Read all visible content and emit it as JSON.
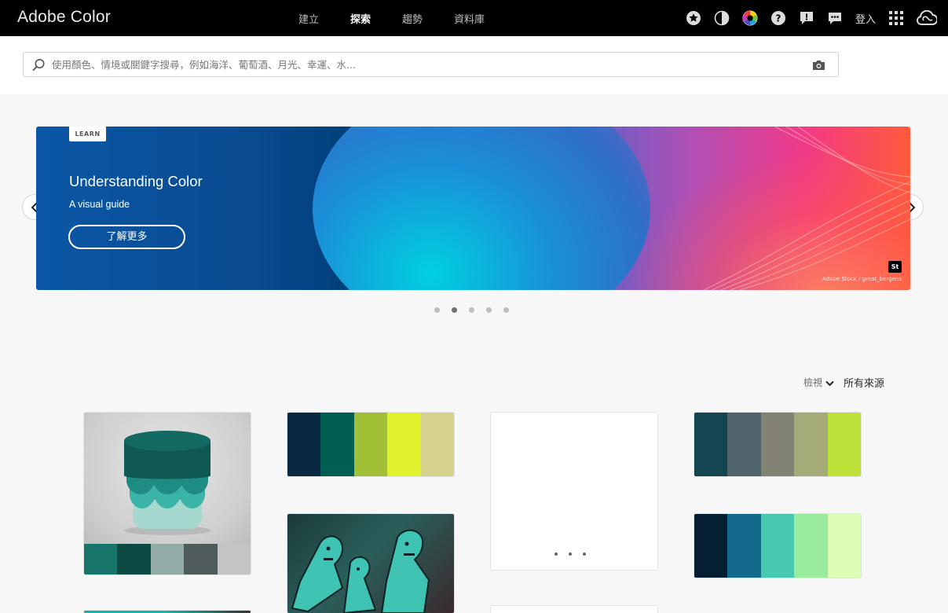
{
  "app": {
    "title": "Adobe Color"
  },
  "nav": {
    "items": [
      {
        "label": "建立",
        "active": false
      },
      {
        "label": "探索",
        "active": true
      },
      {
        "label": "趨勢",
        "active": false
      },
      {
        "label": "資料庫",
        "active": false
      }
    ]
  },
  "toolbar": {
    "icons": [
      "star-icon",
      "contrast-icon",
      "color-wheel-icon",
      "help-icon",
      "feedback-icon",
      "chat-icon"
    ],
    "login_label": "登入",
    "right_icons": [
      "apps-grid-icon",
      "creative-cloud-icon"
    ]
  },
  "search": {
    "placeholder": "使用顏色、情境或關鍵字搜尋，例如海洋、葡萄酒、月光、幸運、水...",
    "value": ""
  },
  "banner": {
    "tag": "LEARN",
    "title": "Understanding Color",
    "subtitle": "A visual guide",
    "button_label": "了解更多",
    "badge": "St",
    "credit": "Adobe Stock / great_bergens"
  },
  "carousel": {
    "count": 5,
    "active_index": 1
  },
  "filter": {
    "label": "檢視",
    "value": "所有來源"
  },
  "colors": {
    "accent": "#0b57a6",
    "card1_palette": [
      "#18756a",
      "#0e4a44",
      "#92aba6",
      "#4f5b5b",
      "#c4c4c4"
    ],
    "card2_palette": [
      "#092842",
      "#005e52",
      "#a1c036",
      "#dff12a",
      "#d6d38f"
    ],
    "card4_palette": [
      "#134650",
      "#50636a",
      "#828372",
      "#a5ab78",
      "#bde038"
    ],
    "card5_palette": [
      "#041f30",
      "#136a8a",
      "#47c9b0",
      "#9beb9e",
      "#dbfdb6"
    ]
  }
}
